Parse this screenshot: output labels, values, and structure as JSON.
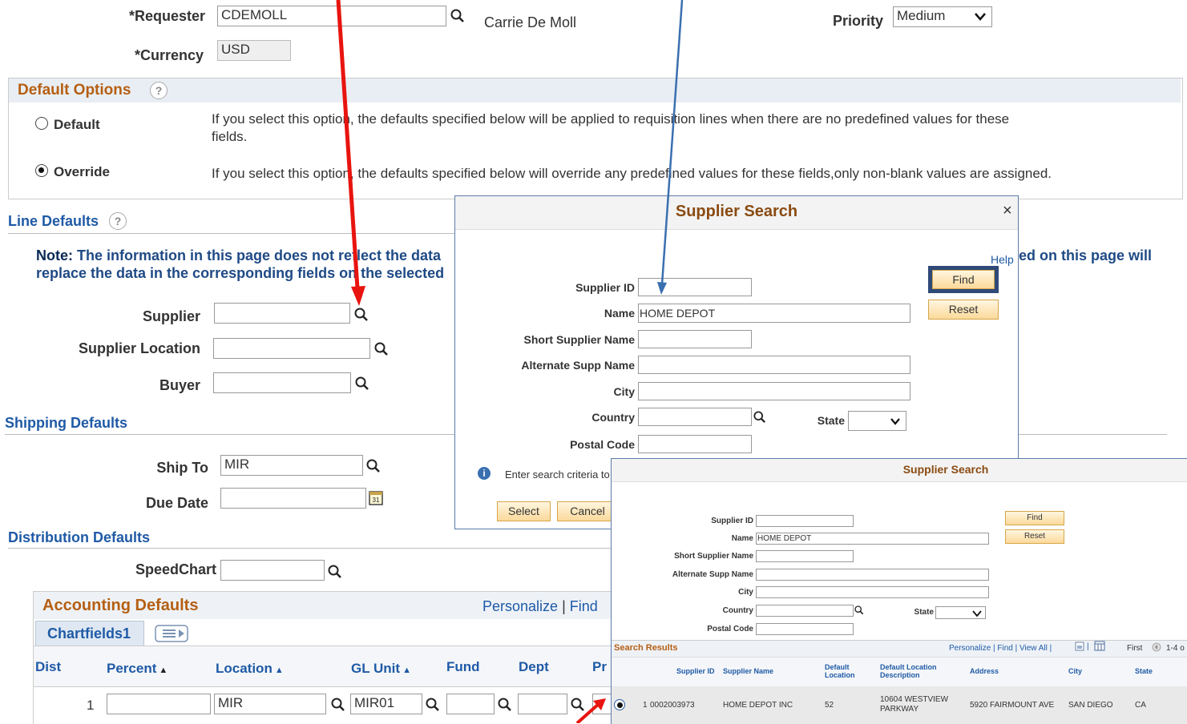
{
  "requester": {
    "label": "*Requester",
    "value": "CDEMOLL",
    "name": "Carrie De Moll"
  },
  "priority": {
    "label": "Priority",
    "value": "Medium"
  },
  "currency": {
    "label": "*Currency",
    "value": "USD"
  },
  "default_options": {
    "title": "Default Options",
    "help": "?",
    "default_label": "Default",
    "default_desc_1": "If you select this option, the defaults specified below will be applied to requisition lines when there are no predefined values for these",
    "default_desc_2": "fields.",
    "override_label": "Override",
    "override_desc": "If you select this option, the defaults specified below will override any predefined values for these fields,only non-blank values are assigned.",
    "selected": "Override"
  },
  "line_defaults": {
    "title": "Line Defaults",
    "help": "?",
    "note_bold": "Note:",
    "note_line1a": "The information in this page does not reflect the data",
    "note_line1b": "ed on this page will",
    "note_line2": "replace the data in the corresponding fields on the selected",
    "supplier_label": "Supplier",
    "supplier_value": "",
    "location_label": "Supplier Location",
    "location_value": "",
    "buyer_label": "Buyer",
    "buyer_value": ""
  },
  "shipping": {
    "title": "Shipping Defaults",
    "ship_to_label": "Ship To",
    "ship_to_value": "MIR",
    "due_date_label": "Due Date",
    "due_date_value": ""
  },
  "distribution": {
    "title": "Distribution Defaults",
    "speedchart_label": "SpeedChart",
    "speedchart_value": ""
  },
  "accounting": {
    "title": "Accounting Defaults",
    "personalize": "Personalize",
    "sep": "|",
    "find": "Find",
    "tab": "Chartfields1",
    "columns": [
      "Dist",
      "Percent",
      "Location",
      "GL Unit",
      "Fund",
      "Dept",
      "Pr"
    ],
    "row": {
      "dist": "1",
      "percent": "",
      "location": "MIR",
      "gl_unit": "MIR01",
      "fund": "",
      "dept": ""
    }
  },
  "dialog1": {
    "title": "Supplier Search",
    "close": "×",
    "help": "Help",
    "supplier_id_label": "Supplier ID",
    "supplier_id_value": "",
    "name_label": "Name",
    "name_value": "HOME DEPOT",
    "short_name_label": "Short Supplier Name",
    "alt_name_label": "Alternate Supp Name",
    "city_label": "City",
    "country_label": "Country",
    "state_label": "State",
    "postal_label": "Postal Code",
    "find": "Find",
    "reset": "Reset",
    "info": "Enter search criteria to",
    "select": "Select",
    "cancel": "Cancel"
  },
  "dialog2": {
    "title": "Supplier Search",
    "supplier_id_label": "Supplier ID",
    "name_label": "Name",
    "name_value": "HOME DEPOT",
    "short_name_label": "Short Supplier Name",
    "alt_name_label": "Alternate Supp Name",
    "city_label": "City",
    "country_label": "Country",
    "state_label": "State",
    "postal_label": "Postal Code",
    "find": "Find",
    "reset": "Reset",
    "results_title": "Search Results",
    "results_nav": "Personalize | Find | View All |",
    "results_pager": "First",
    "results_range": "1-4 o",
    "columns": [
      "Supplier ID",
      "Supplier Name",
      "Default Location",
      "Default Location Description",
      "Address",
      "City",
      "State"
    ],
    "row": {
      "num": "1",
      "supplier_id": "0002003973",
      "supplier_name": "HOME DEPOT INC",
      "location": "52",
      "location_desc": "10604 WESTVIEW PARKWAY",
      "address": "5920 FAIRMOUNT AVE",
      "city": "SAN DIEGO",
      "state": "CA"
    }
  },
  "colors": {
    "link": "#1f5aa6",
    "section": "#8a4b12",
    "arrow_red": "#e8140f",
    "arrow_blue": "#3a6fb0"
  }
}
